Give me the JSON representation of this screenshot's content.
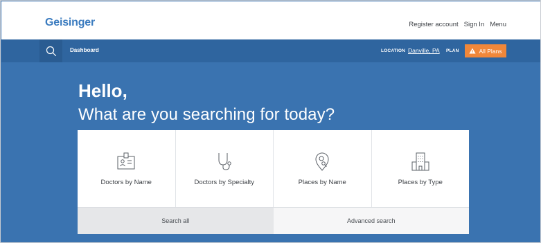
{
  "brand": {
    "logo_text": "Geisinger",
    "logo_color": "#3a7bbf"
  },
  "header": {
    "links": [
      "Register account",
      "Sign In",
      "Menu"
    ]
  },
  "nav": {
    "search_icon": "search-icon",
    "dashboard_label": "Dashboard",
    "location_label": "LOCATION",
    "location_value": "Danville, PA",
    "plan_label": "PLAN",
    "plans_button_label": "All Plans",
    "plans_button_icon": "warning-icon",
    "accent_color": "#f0873a",
    "bar_color": "#2f659f"
  },
  "hero": {
    "greeting": "Hello,",
    "question": "What are you searching for today?",
    "background": "#3a73b0"
  },
  "cards": [
    {
      "label": "Doctors by Name",
      "icon": "id-badge-icon"
    },
    {
      "label": "Doctors by Specialty",
      "icon": "stethoscope-icon"
    },
    {
      "label": "Places by Name",
      "icon": "location-search-icon"
    },
    {
      "label": "Places by Type",
      "icon": "building-icon"
    }
  ],
  "actions": {
    "search_all": "Search all",
    "advanced_search": "Advanced search"
  }
}
